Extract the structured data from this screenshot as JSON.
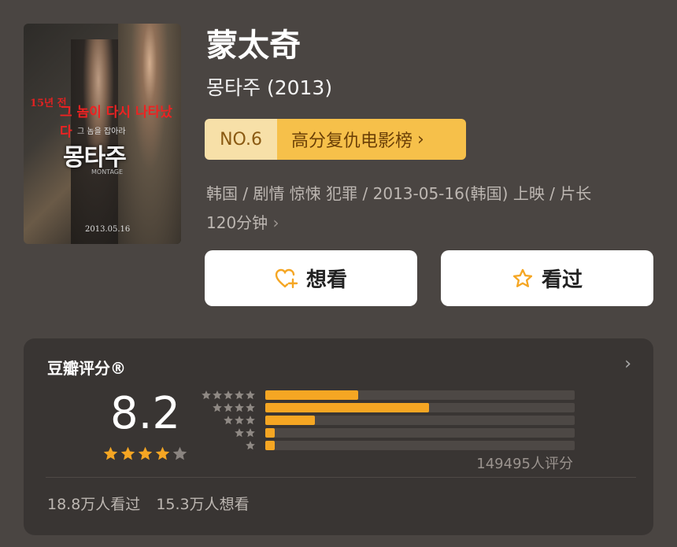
{
  "poster": {
    "line1": "15년 전",
    "line2": "그 놈이 다시 나타났다",
    "line3": "그 놈을 잡아라",
    "title": "몽타주",
    "subtitle": "MONTAGE",
    "date": "2013.05.16"
  },
  "movie": {
    "title": "蒙太奇",
    "original_title": "몽타주 (2013)",
    "meta_line1": "韩国 / 剧情 惊悚 犯罪 / 2013-05-16(韩国) 上映 / 片长",
    "meta_line2": "120分钟",
    "meta_chevron": "›"
  },
  "rank": {
    "number": "NO.6",
    "list_name": "高分复仇电影榜",
    "chevron": "›"
  },
  "actions": {
    "want_label": "想看",
    "seen_label": "看过",
    "want_icon": "heart-plus-icon",
    "seen_icon": "star-outline-icon",
    "icon_color": "#f5a623"
  },
  "rating": {
    "header": "豆瓣评分®",
    "chevron": "›",
    "score": "8.2",
    "stars": 4,
    "distribution": [
      {
        "stars": 5,
        "fraction": 0.3
      },
      {
        "stars": 4,
        "fraction": 0.53
      },
      {
        "stars": 3,
        "fraction": 0.16
      },
      {
        "stars": 2,
        "fraction": 0.03
      },
      {
        "stars": 1,
        "fraction": 0.03
      }
    ],
    "count_text": "149495人评分",
    "seen_text": "18.8万人看过",
    "want_text": "15.3万人想看",
    "accent": "#f5a623"
  }
}
